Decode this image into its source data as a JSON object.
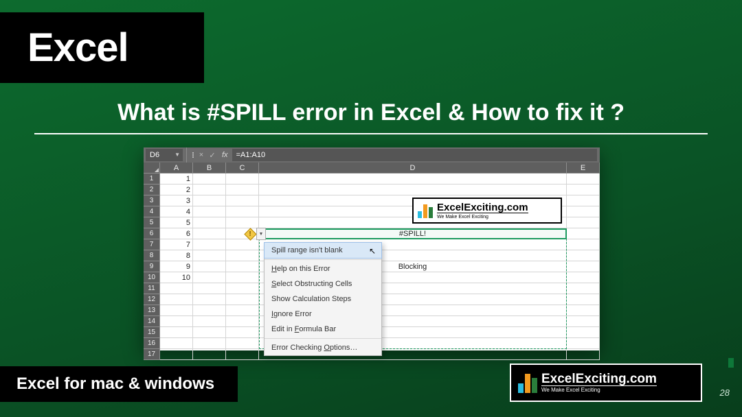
{
  "title": "Excel",
  "subtitle": "What is #SPILL error in Excel & How to fix it ?",
  "footer": "Excel for mac & windows",
  "page_number": "28",
  "logo": {
    "main": "ExcelExciting.com",
    "sub": "We Make Excel Exciting"
  },
  "excel": {
    "name_box": "D6",
    "fx_label": "fx",
    "formula": "=A1:A10",
    "fx_cancel": "×",
    "fx_enter": "✓",
    "columns": [
      "A",
      "B",
      "C",
      "D",
      "E"
    ],
    "rows": [
      "1",
      "2",
      "3",
      "4",
      "5",
      "6",
      "7",
      "8",
      "9",
      "10",
      "11",
      "12",
      "13",
      "14",
      "15",
      "16",
      "17"
    ],
    "colA_values": [
      "1",
      "2",
      "3",
      "4",
      "5",
      "6",
      "7",
      "8",
      "9",
      "10",
      "",
      "",
      "",
      "",
      "",
      "",
      ""
    ],
    "d6_value": "#SPILL!",
    "d9_value": "Blocking"
  },
  "menu": {
    "items": [
      "Spill range isn't blank",
      "Help on this Error",
      "Select Obstructing Cells",
      "Show Calculation Steps",
      "Ignore Error",
      "Edit in Formula Bar",
      "Error Checking Options…"
    ]
  }
}
